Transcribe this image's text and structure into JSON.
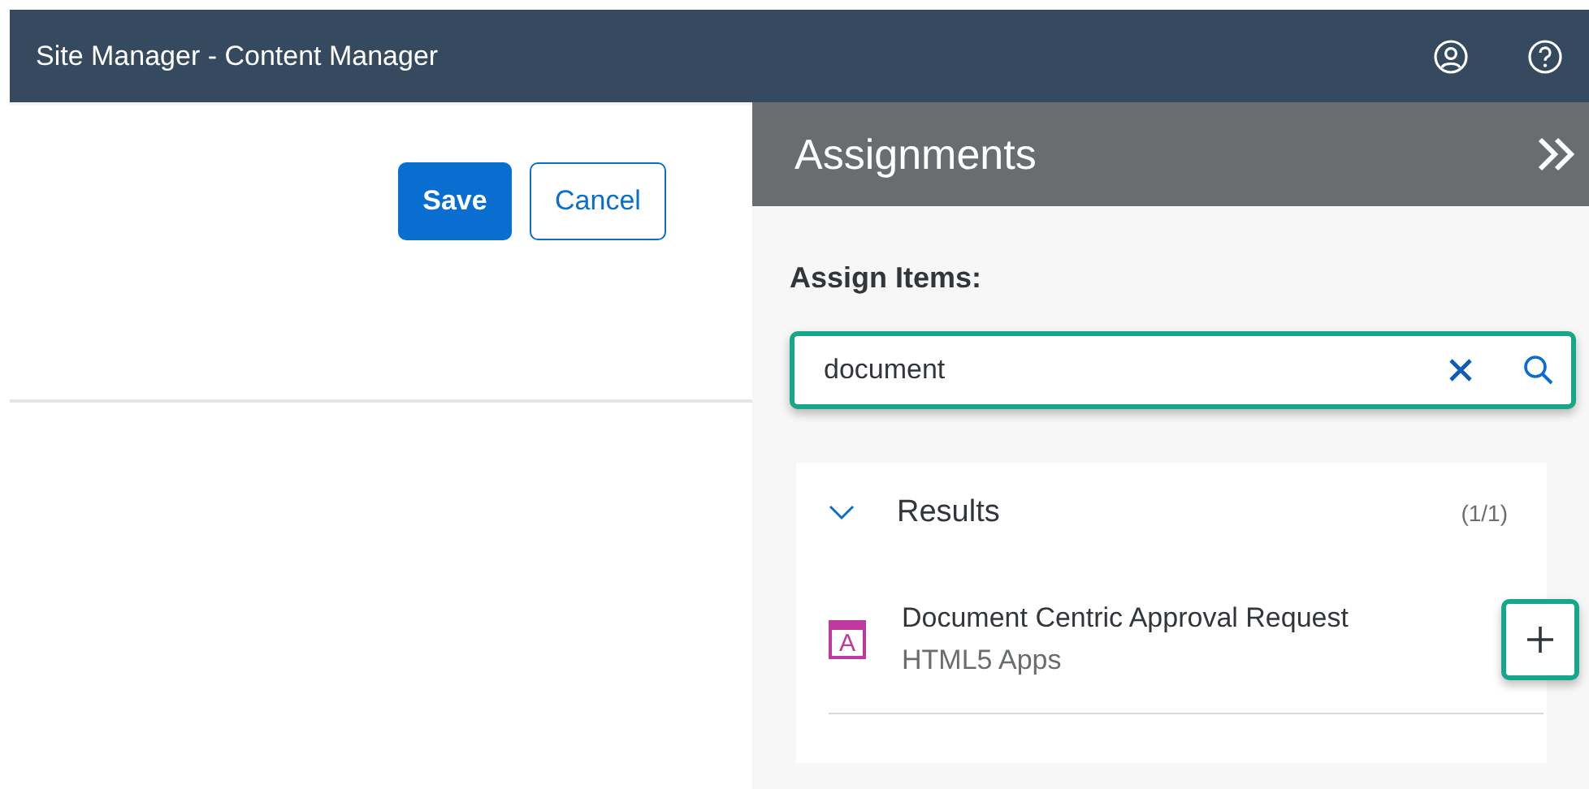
{
  "shell": {
    "title": "Site Manager - Content Manager"
  },
  "form": {
    "buttons": [
      {
        "label": "Save",
        "kind": "primary"
      },
      {
        "label": "Cancel",
        "kind": "secondary"
      }
    ]
  },
  "panel": {
    "title": "Assignments",
    "label": "Assign Items:",
    "search": {
      "value": "document"
    },
    "results": {
      "title": "Results",
      "count": "(1/1)",
      "expanded": true,
      "items": [
        {
          "title": "Document Centric Approval Request",
          "subtitle": "HTML5 Apps",
          "icon_letter": "A"
        }
      ]
    }
  }
}
